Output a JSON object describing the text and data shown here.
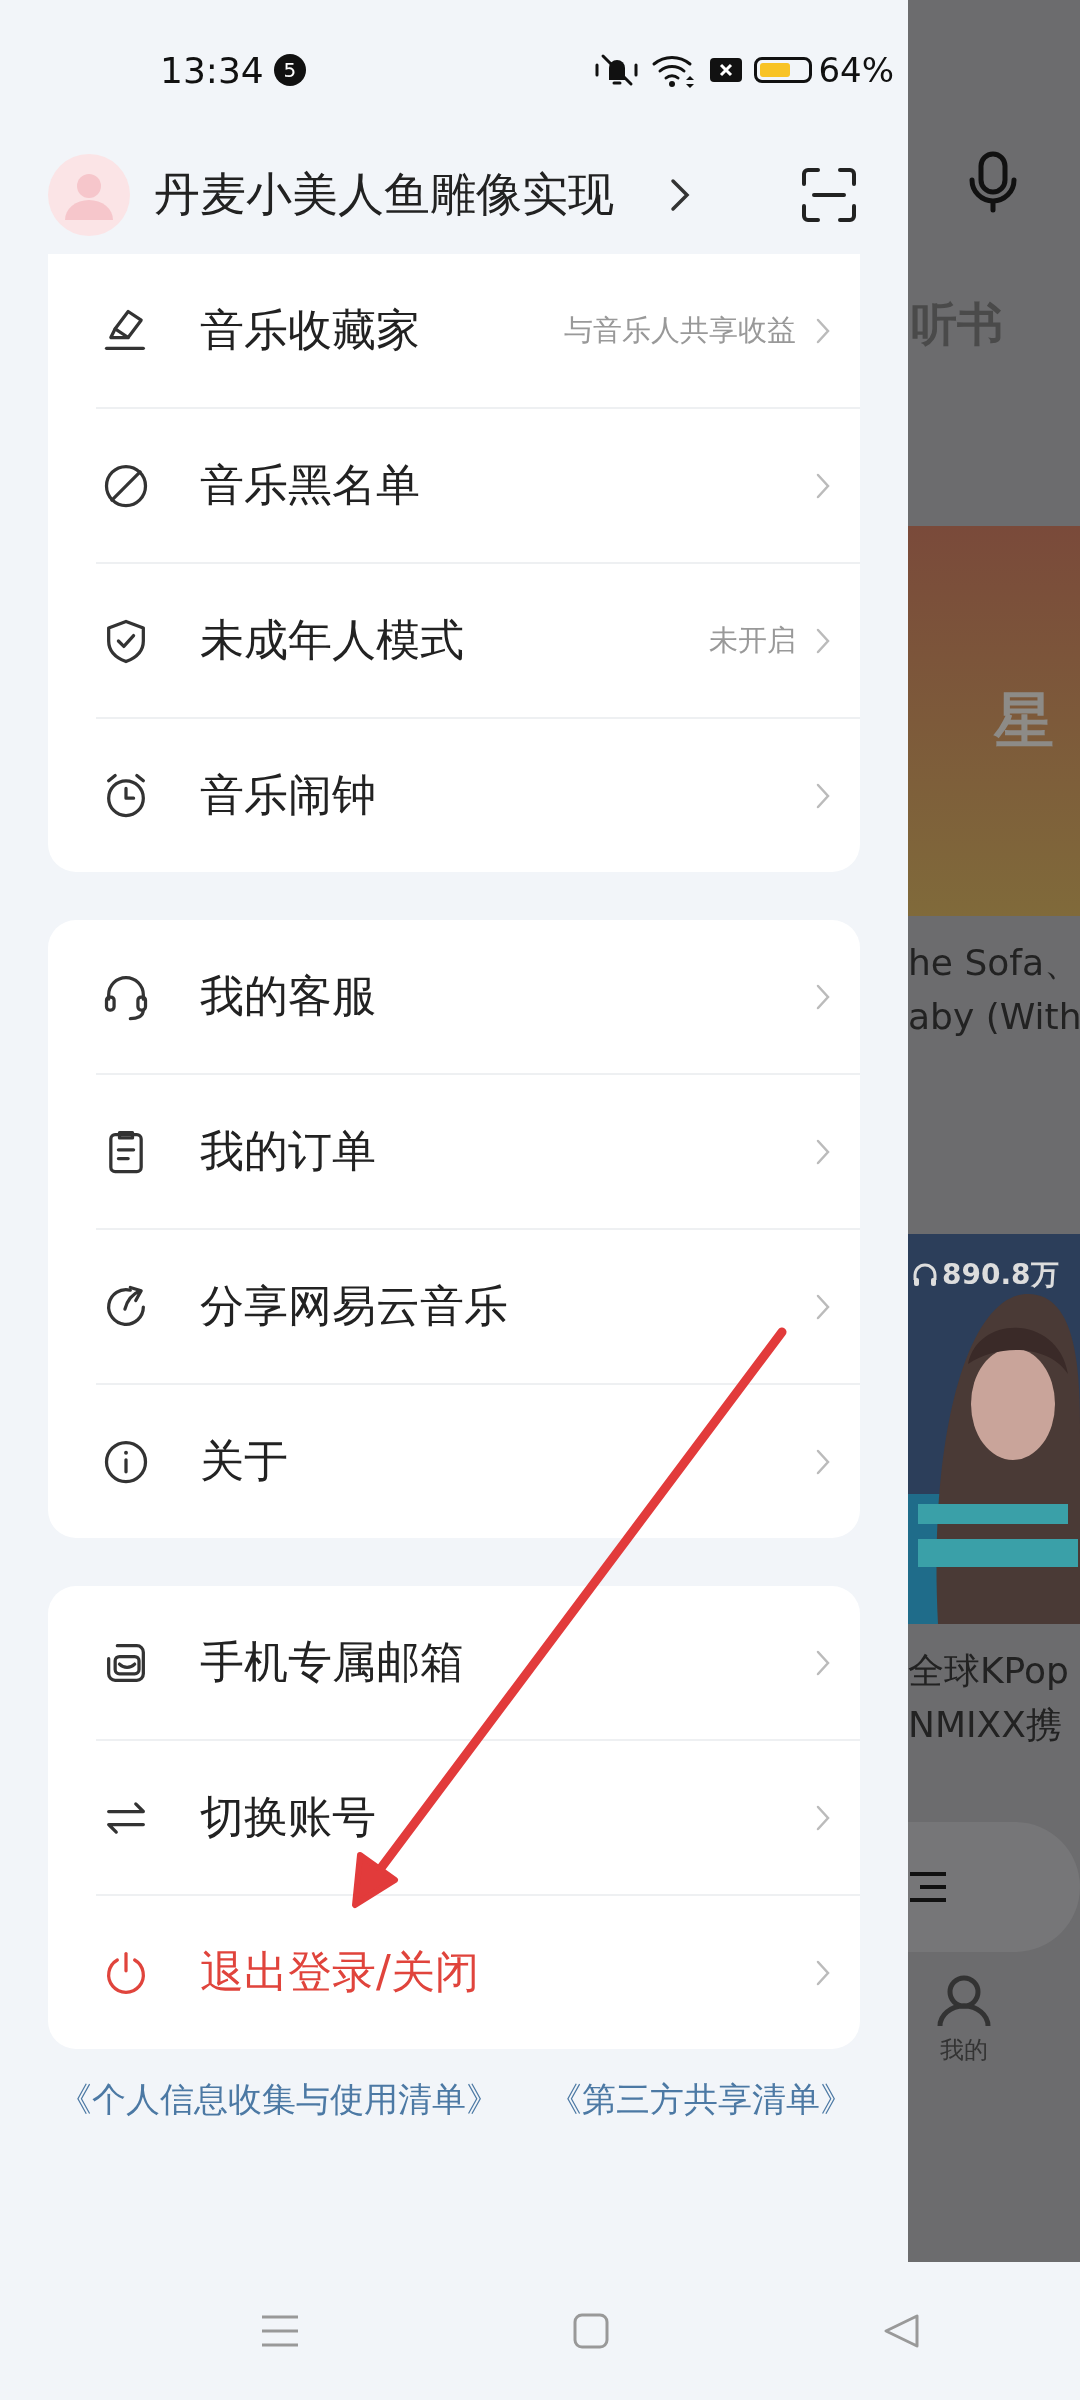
{
  "status_bar": {
    "time": "13:34",
    "notification_count": "5",
    "battery_text": "64%"
  },
  "profile": {
    "name": "丹麦小美人鱼雕像实现"
  },
  "menu_groups": [
    {
      "items": [
        {
          "label": "音乐收藏家",
          "hint": "与音乐人共享收益",
          "kind": "normal"
        },
        {
          "label": "音乐黑名单",
          "kind": "normal"
        },
        {
          "label": "未成年人模式",
          "hint": "未开启",
          "kind": "normal"
        },
        {
          "label": "音乐闹钟",
          "kind": "normal"
        }
      ]
    },
    {
      "items": [
        {
          "label": "我的客服",
          "kind": "normal"
        },
        {
          "label": "我的订单",
          "kind": "normal"
        },
        {
          "label": "分享网易云音乐",
          "kind": "normal"
        },
        {
          "label": "关于",
          "kind": "normal"
        }
      ]
    },
    {
      "items": [
        {
          "label": "手机专属邮箱",
          "kind": "normal"
        },
        {
          "label": "切换账号",
          "kind": "normal"
        },
        {
          "label": "退出登录/关闭",
          "kind": "danger"
        }
      ]
    }
  ],
  "links": [
    "《个人信息收集与使用清单》",
    "《第三方共享清单》"
  ],
  "background_page": {
    "tab": "听书",
    "banner_text": "星",
    "song_lines": [
      "he Sofa、",
      "aby (With"
    ],
    "play_count": "890.8万",
    "playlist_lines": [
      "全球KPop",
      "NMIXX携"
    ],
    "nav_label": "我的"
  }
}
